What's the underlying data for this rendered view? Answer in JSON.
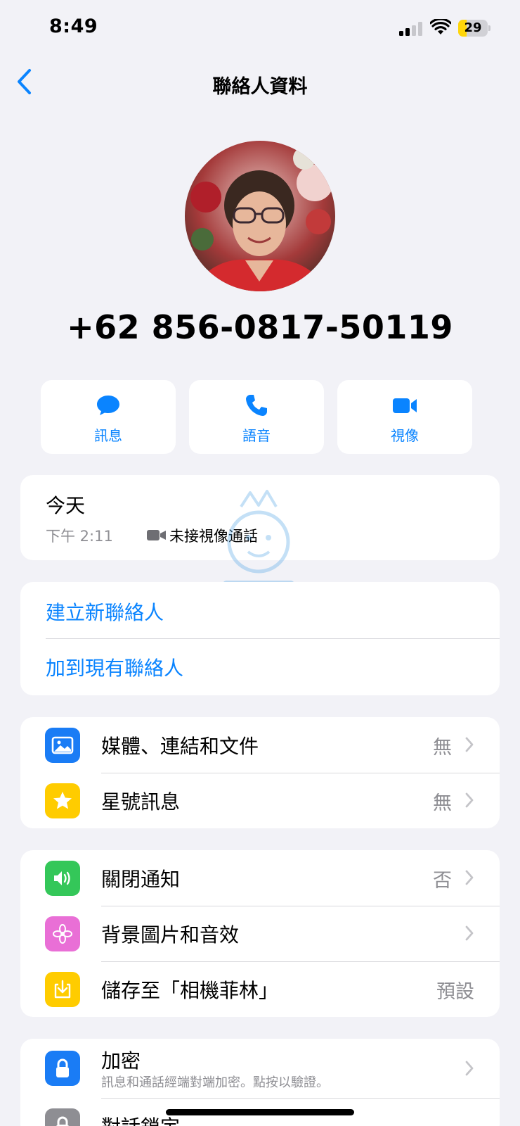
{
  "status": {
    "time": "8:49",
    "battery": "29",
    "battery_level": 0.29
  },
  "nav": {
    "title": "聯絡人資料",
    "back_icon": "chevron-left-icon"
  },
  "contact": {
    "phone": "+62 856-0817-50119"
  },
  "actions": [
    {
      "label": "訊息",
      "icon": "message-bubble-icon"
    },
    {
      "label": "語音",
      "icon": "phone-icon"
    },
    {
      "label": "視像",
      "icon": "video-camera-icon"
    }
  ],
  "call_log": {
    "day": "今天",
    "time": "下午 2:11",
    "description": "未接視像通話"
  },
  "contact_actions": {
    "create_new": "建立新聯絡人",
    "add_existing": "加到現有聯絡人"
  },
  "media_group": [
    {
      "label": "媒體、連結和文件",
      "value": "無",
      "icon": "photo-icon",
      "color": "#1a7cf5"
    },
    {
      "label": "星號訊息",
      "value": "無",
      "icon": "star-icon",
      "color": "#ffcc00"
    }
  ],
  "settings_group": [
    {
      "label": "關閉通知",
      "value": "否",
      "icon": "speaker-icon",
      "color": "#34c759"
    },
    {
      "label": "背景圖片和音效",
      "value": "",
      "icon": "flower-icon",
      "color": "#e96fd6"
    },
    {
      "label": "儲存至「相機菲林」",
      "value": "預設",
      "icon": "download-icon",
      "color": "#ffcc00"
    }
  ],
  "security_group": [
    {
      "label": "加密",
      "sub": "訊息和通話經端對端加密。點按以驗證。",
      "icon": "lock-icon",
      "color": "#1a7cf5"
    },
    {
      "label": "對話鎖定",
      "icon": "lock-chat-icon",
      "color": "#8e8e93"
    }
  ],
  "colors": {
    "accent": "#0a84ff",
    "background": "#f2f2f7",
    "battery": "#ffd60a"
  }
}
